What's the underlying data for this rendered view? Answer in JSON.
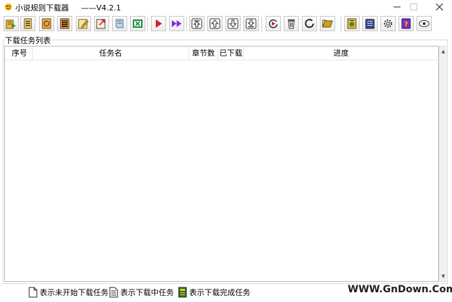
{
  "window": {
    "title": "小说规则下载器     ——V4.2.1"
  },
  "toolbar": {
    "buttons": [
      {
        "icon": "add-task-icon"
      },
      {
        "icon": "document-list-icon"
      },
      {
        "icon": "refresh-book-icon"
      },
      {
        "icon": "ledger-icon"
      },
      {
        "icon": "edit-icon"
      },
      {
        "icon": "export-icon"
      },
      {
        "icon": "notebook-icon"
      },
      {
        "icon": "excel-icon"
      },
      {
        "icon": "start-icon"
      },
      {
        "icon": "start-all-icon"
      },
      {
        "icon": "move-top-icon"
      },
      {
        "icon": "move-up-icon"
      },
      {
        "icon": "move-down-icon"
      },
      {
        "icon": "move-bottom-icon"
      },
      {
        "icon": "retry-icon"
      },
      {
        "icon": "delete-icon"
      },
      {
        "icon": "stop-icon"
      },
      {
        "icon": "folder-icon"
      },
      {
        "icon": "rules-icon"
      },
      {
        "icon": "notepad-icon"
      },
      {
        "icon": "settings-icon"
      },
      {
        "icon": "help-icon"
      },
      {
        "icon": "about-icon"
      }
    ]
  },
  "task_group": {
    "label": "下载任务列表"
  },
  "task_list": {
    "columns": [
      "序号",
      "任务名",
      "章节数",
      "已下载",
      "进度"
    ],
    "rows": []
  },
  "legend": {
    "not_started": "表示未开始下载任务",
    "downloading": "表示下载中任务",
    "finished": "表示下载完成任务"
  },
  "watermark": "WWW.GnDown.Com",
  "colors": {
    "play": "#d02030",
    "play_all": "#8a2be2",
    "excel": "#1f8a3c",
    "help": "#7b2fbf"
  }
}
